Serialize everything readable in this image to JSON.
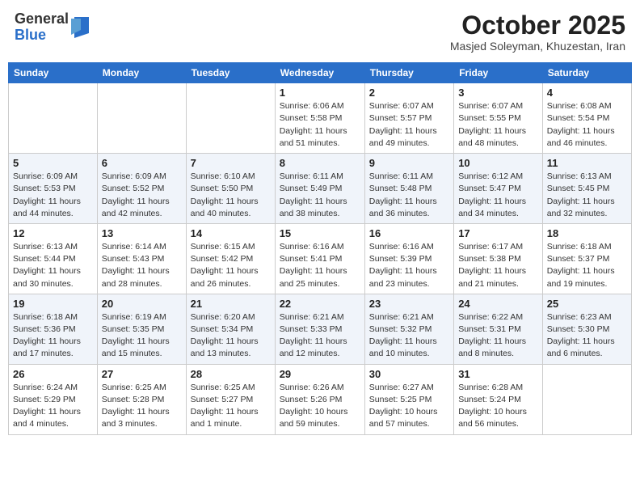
{
  "header": {
    "logo_general": "General",
    "logo_blue": "Blue",
    "month_title": "October 2025",
    "location": "Masjed Soleyman, Khuzestan, Iran"
  },
  "weekdays": [
    "Sunday",
    "Monday",
    "Tuesday",
    "Wednesday",
    "Thursday",
    "Friday",
    "Saturday"
  ],
  "weeks": [
    [
      {
        "day": "",
        "info": ""
      },
      {
        "day": "",
        "info": ""
      },
      {
        "day": "",
        "info": ""
      },
      {
        "day": "1",
        "info": "Sunrise: 6:06 AM\nSunset: 5:58 PM\nDaylight: 11 hours\nand 51 minutes."
      },
      {
        "day": "2",
        "info": "Sunrise: 6:07 AM\nSunset: 5:57 PM\nDaylight: 11 hours\nand 49 minutes."
      },
      {
        "day": "3",
        "info": "Sunrise: 6:07 AM\nSunset: 5:55 PM\nDaylight: 11 hours\nand 48 minutes."
      },
      {
        "day": "4",
        "info": "Sunrise: 6:08 AM\nSunset: 5:54 PM\nDaylight: 11 hours\nand 46 minutes."
      }
    ],
    [
      {
        "day": "5",
        "info": "Sunrise: 6:09 AM\nSunset: 5:53 PM\nDaylight: 11 hours\nand 44 minutes."
      },
      {
        "day": "6",
        "info": "Sunrise: 6:09 AM\nSunset: 5:52 PM\nDaylight: 11 hours\nand 42 minutes."
      },
      {
        "day": "7",
        "info": "Sunrise: 6:10 AM\nSunset: 5:50 PM\nDaylight: 11 hours\nand 40 minutes."
      },
      {
        "day": "8",
        "info": "Sunrise: 6:11 AM\nSunset: 5:49 PM\nDaylight: 11 hours\nand 38 minutes."
      },
      {
        "day": "9",
        "info": "Sunrise: 6:11 AM\nSunset: 5:48 PM\nDaylight: 11 hours\nand 36 minutes."
      },
      {
        "day": "10",
        "info": "Sunrise: 6:12 AM\nSunset: 5:47 PM\nDaylight: 11 hours\nand 34 minutes."
      },
      {
        "day": "11",
        "info": "Sunrise: 6:13 AM\nSunset: 5:45 PM\nDaylight: 11 hours\nand 32 minutes."
      }
    ],
    [
      {
        "day": "12",
        "info": "Sunrise: 6:13 AM\nSunset: 5:44 PM\nDaylight: 11 hours\nand 30 minutes."
      },
      {
        "day": "13",
        "info": "Sunrise: 6:14 AM\nSunset: 5:43 PM\nDaylight: 11 hours\nand 28 minutes."
      },
      {
        "day": "14",
        "info": "Sunrise: 6:15 AM\nSunset: 5:42 PM\nDaylight: 11 hours\nand 26 minutes."
      },
      {
        "day": "15",
        "info": "Sunrise: 6:16 AM\nSunset: 5:41 PM\nDaylight: 11 hours\nand 25 minutes."
      },
      {
        "day": "16",
        "info": "Sunrise: 6:16 AM\nSunset: 5:39 PM\nDaylight: 11 hours\nand 23 minutes."
      },
      {
        "day": "17",
        "info": "Sunrise: 6:17 AM\nSunset: 5:38 PM\nDaylight: 11 hours\nand 21 minutes."
      },
      {
        "day": "18",
        "info": "Sunrise: 6:18 AM\nSunset: 5:37 PM\nDaylight: 11 hours\nand 19 minutes."
      }
    ],
    [
      {
        "day": "19",
        "info": "Sunrise: 6:18 AM\nSunset: 5:36 PM\nDaylight: 11 hours\nand 17 minutes."
      },
      {
        "day": "20",
        "info": "Sunrise: 6:19 AM\nSunset: 5:35 PM\nDaylight: 11 hours\nand 15 minutes."
      },
      {
        "day": "21",
        "info": "Sunrise: 6:20 AM\nSunset: 5:34 PM\nDaylight: 11 hours\nand 13 minutes."
      },
      {
        "day": "22",
        "info": "Sunrise: 6:21 AM\nSunset: 5:33 PM\nDaylight: 11 hours\nand 12 minutes."
      },
      {
        "day": "23",
        "info": "Sunrise: 6:21 AM\nSunset: 5:32 PM\nDaylight: 11 hours\nand 10 minutes."
      },
      {
        "day": "24",
        "info": "Sunrise: 6:22 AM\nSunset: 5:31 PM\nDaylight: 11 hours\nand 8 minutes."
      },
      {
        "day": "25",
        "info": "Sunrise: 6:23 AM\nSunset: 5:30 PM\nDaylight: 11 hours\nand 6 minutes."
      }
    ],
    [
      {
        "day": "26",
        "info": "Sunrise: 6:24 AM\nSunset: 5:29 PM\nDaylight: 11 hours\nand 4 minutes."
      },
      {
        "day": "27",
        "info": "Sunrise: 6:25 AM\nSunset: 5:28 PM\nDaylight: 11 hours\nand 3 minutes."
      },
      {
        "day": "28",
        "info": "Sunrise: 6:25 AM\nSunset: 5:27 PM\nDaylight: 11 hours\nand 1 minute."
      },
      {
        "day": "29",
        "info": "Sunrise: 6:26 AM\nSunset: 5:26 PM\nDaylight: 10 hours\nand 59 minutes."
      },
      {
        "day": "30",
        "info": "Sunrise: 6:27 AM\nSunset: 5:25 PM\nDaylight: 10 hours\nand 57 minutes."
      },
      {
        "day": "31",
        "info": "Sunrise: 6:28 AM\nSunset: 5:24 PM\nDaylight: 10 hours\nand 56 minutes."
      },
      {
        "day": "",
        "info": ""
      }
    ]
  ]
}
